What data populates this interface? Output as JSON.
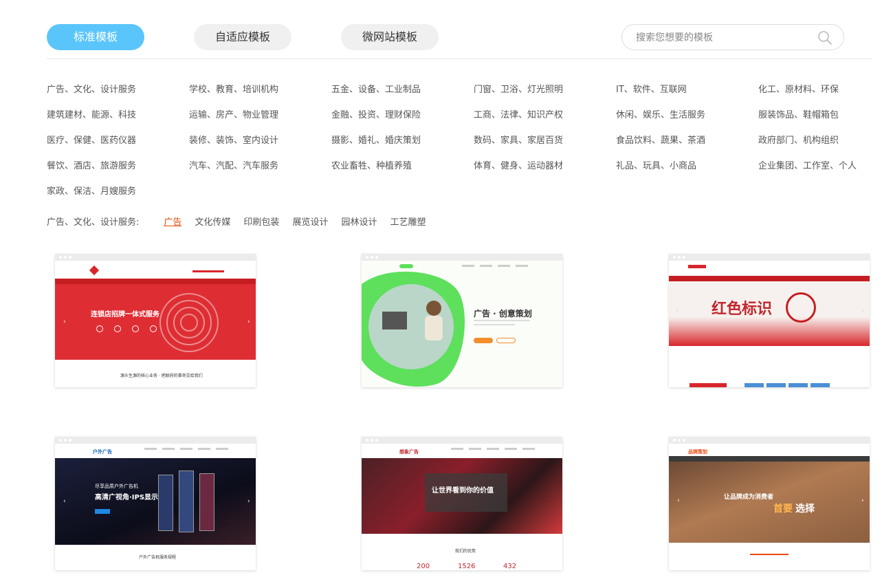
{
  "tabs": [
    {
      "label": "标准模板"
    },
    {
      "label": "自适应模板"
    },
    {
      "label": "微网站模板"
    }
  ],
  "search": {
    "placeholder": "搜索您想要的模板"
  },
  "categories": [
    "广告、文化、设计服务",
    "学校、教育、培训机构",
    "五金、设备、工业制品",
    "门窗、卫浴、灯光照明",
    "IT、软件、互联网",
    "化工、原材料、环保",
    "建筑建材、能源、科技",
    "运输、房产、物业管理",
    "金融、投资、理财保险",
    "工商、法律、知识产权",
    "休闲、娱乐、生活服务",
    "服装饰品、鞋帽箱包",
    "医疗、保健、医药仪器",
    "装修、装饰、室内设计",
    "摄影、婚礼、婚庆策划",
    "数码、家具、家居百货",
    "食品饮料、蔬果、茶酒",
    "政府部门、机构组织",
    "餐饮、酒店、旅游服务",
    "汽车、汽配、汽车服务",
    "农业畜牲、种植养殖",
    "体育、健身、运动器材",
    "礼品、玩具、小商品",
    "企业集团、工作室、个人",
    "家政、保洁、月嫂服务"
  ],
  "subcategory_bar": {
    "label": "广告、文化、设计服务:",
    "items": [
      "广告",
      "文化传媒",
      "印刷包装",
      "展览设计",
      "园林设计",
      "工艺雕塑"
    ]
  },
  "templates": [
    {
      "hero_title": "连锁店招牌一体式服务",
      "footer_text": "源头生源的核心业务 · 把联府的事务交给我们"
    },
    {
      "hero_title": "广告 · 创意策划"
    },
    {
      "hero_title": "红色标识"
    },
    {
      "brand": "户外广告",
      "hero_line1": "尽享品质户外广告机",
      "hero_title": "高清广视角·IPS显示",
      "footer_text": "户外广告机服务规程"
    },
    {
      "brand": "想象广告",
      "hero_title": "让世界看到你的价值",
      "section_title": "我们的优势",
      "stats": [
        "200",
        "1526",
        "432"
      ]
    },
    {
      "brand": "品牌策划",
      "hero_line1": "让品牌成为消费者",
      "hero_accent": "首要",
      "hero_title": "选择"
    }
  ],
  "colors": {
    "accent_blue": "#5ac5fb",
    "active_sub": "#e84b0f",
    "template_red": "#d9262c",
    "template_green": "#5ee05c",
    "stat_red": "#c0272d"
  }
}
